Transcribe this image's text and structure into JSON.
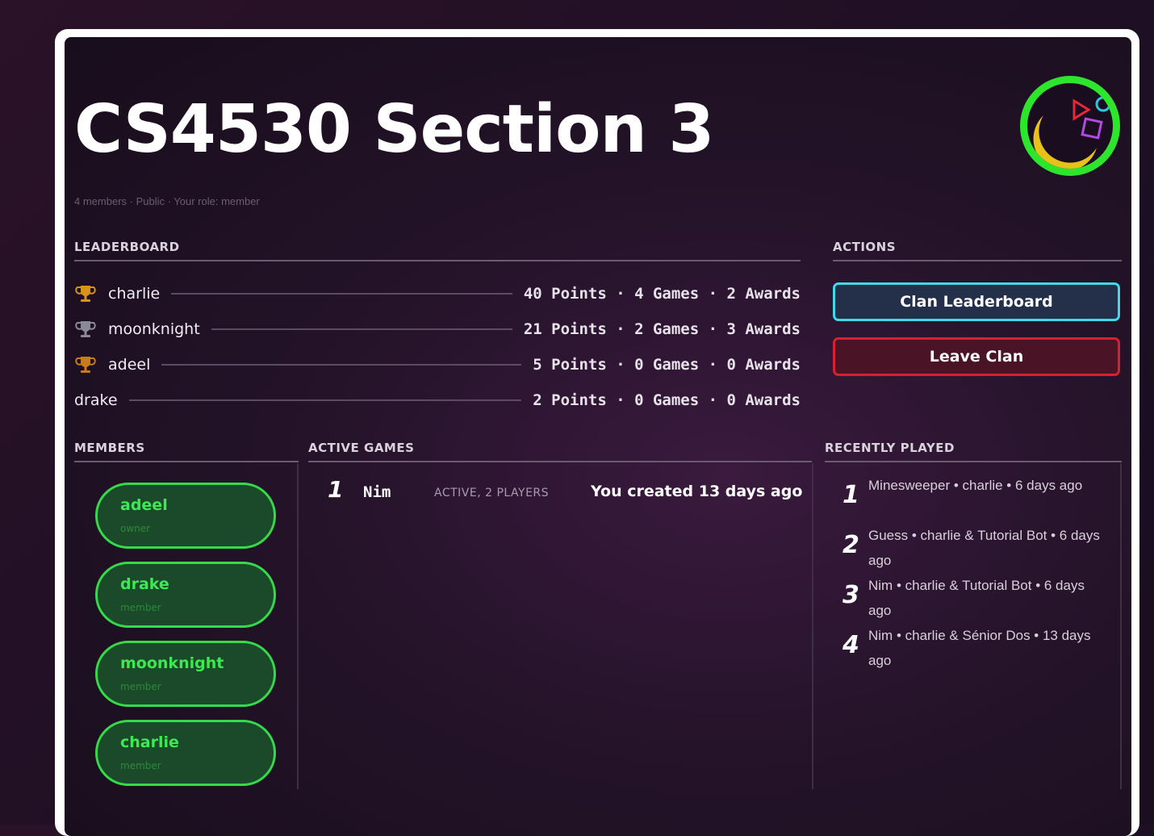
{
  "clan": {
    "title": "CS4530 Section 3",
    "subtitle": "4 members · Public · Your role: member"
  },
  "leaderboard": {
    "heading": "LEADERBOARD",
    "rows": [
      {
        "name": "charlie",
        "stats": "40 Points · 4 Games · 2 Awards",
        "trophy": "gold-trophy-icon",
        "trophy_color": "#d9921a"
      },
      {
        "name": "moonknight",
        "stats": "21 Points · 2 Games · 3 Awards",
        "trophy": "silver-trophy-icon",
        "trophy_color": "#8a8a96"
      },
      {
        "name": "adeel",
        "stats": "5 Points · 0 Games · 0 Awards",
        "trophy": "bronze-trophy-icon",
        "trophy_color": "#c87a1e"
      },
      {
        "name": "drake",
        "stats": "2 Points · 0 Games · 0 Awards",
        "trophy": null
      }
    ]
  },
  "actions": {
    "heading": "ACTIONS",
    "clan_leaderboard_label": "Clan Leaderboard",
    "leave_clan_label": "Leave Clan"
  },
  "members": {
    "heading": "MEMBERS",
    "items": [
      {
        "name": "adeel",
        "role": "owner"
      },
      {
        "name": "drake",
        "role": "member"
      },
      {
        "name": "moonknight",
        "role": "member"
      },
      {
        "name": "charlie",
        "role": "member"
      }
    ]
  },
  "active_games": {
    "heading": "ACTIVE GAMES",
    "items": [
      {
        "rank": "1",
        "name": "Nim",
        "status": "ACTIVE, 2 PLAYERS",
        "time": "You created 13 days ago"
      }
    ]
  },
  "recently_played": {
    "heading": "RECENTLY PLAYED",
    "items": [
      {
        "rank": "1",
        "text": "Minesweeper • charlie • 6 days ago"
      },
      {
        "rank": "2",
        "text": "Guess • charlie & Tutorial Bot • 6 days ago"
      },
      {
        "rank": "3",
        "text": "Nim • charlie & Tutorial Bot • 6 days ago"
      },
      {
        "rank": "4",
        "text": "Nim • charlie & Sénior Dos • 13 days ago"
      }
    ]
  },
  "colors": {
    "accent_green": "#35d94a",
    "accent_cyan": "#3fd9ea",
    "accent_red": "#d8202e"
  }
}
